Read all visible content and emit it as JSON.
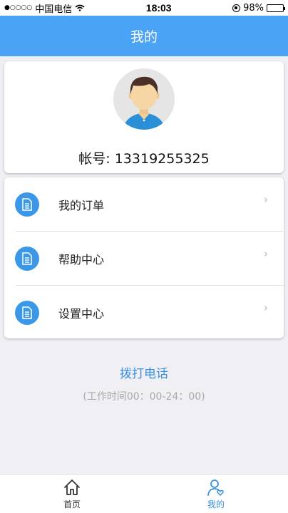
{
  "status_bar": {
    "carrier": "中国电信",
    "signal": "●○○○○",
    "time": "18:03",
    "battery_percent": "98%",
    "battery_level": 0.98
  },
  "header": {
    "title": "我的"
  },
  "profile": {
    "account_text": "帐号: 13319255325"
  },
  "menu": {
    "items": [
      {
        "label": "我的订单",
        "icon": "document-icon"
      },
      {
        "label": "帮助中心",
        "icon": "document-icon"
      },
      {
        "label": "设置中心",
        "icon": "document-icon"
      }
    ],
    "chevron": "›"
  },
  "contact": {
    "call_label": "拨打电话",
    "hours_text": "(工作时间00：00-24：00)"
  },
  "tab_bar": {
    "tabs": [
      {
        "label": "首页",
        "icon": "home-icon",
        "active": false
      },
      {
        "label": "我的",
        "icon": "user-heart-icon",
        "active": true
      }
    ]
  },
  "colors": {
    "accent": "#4ba3f5",
    "link": "#3a8fe0",
    "icon_bg": "#3b97e8",
    "background": "#efeff4"
  }
}
